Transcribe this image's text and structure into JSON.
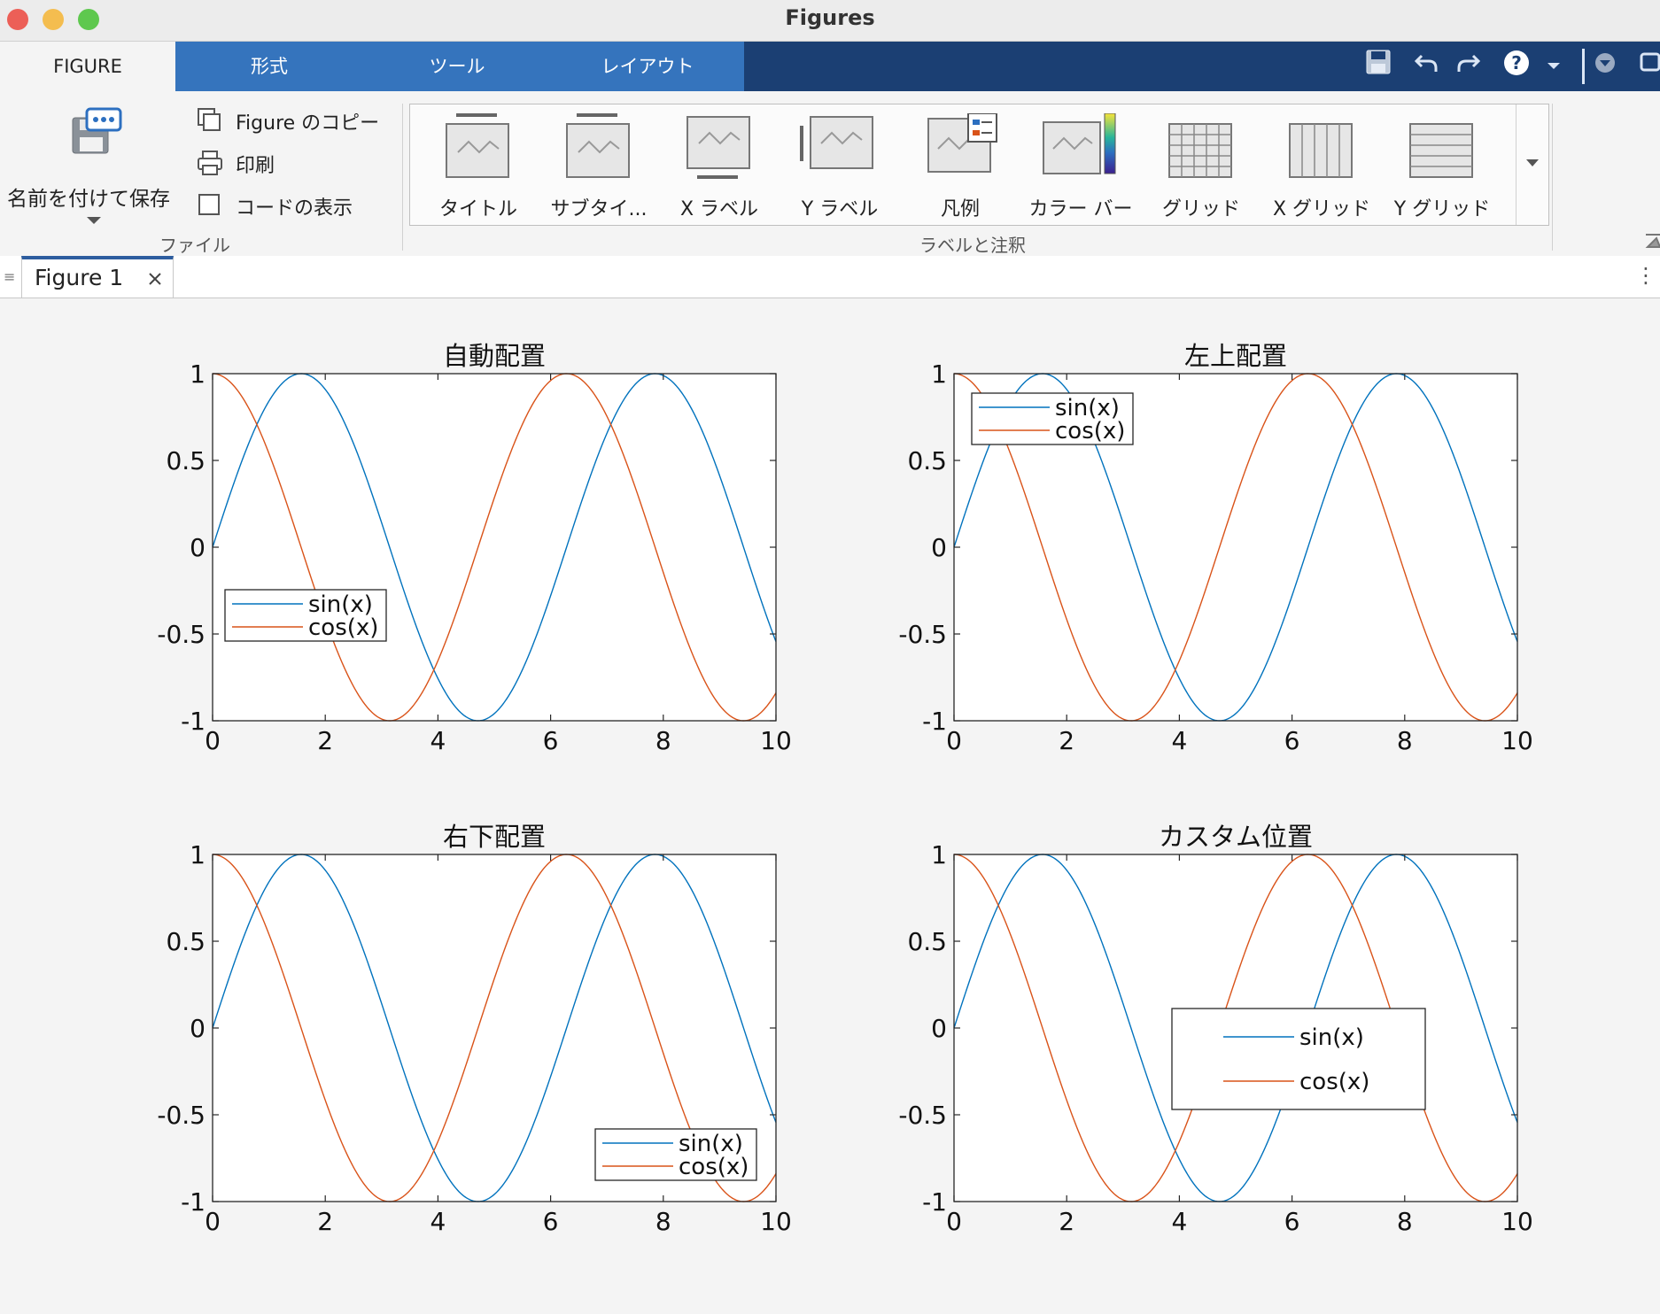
{
  "window": {
    "title": "Figures"
  },
  "ribbon_tabs": [
    "FIGURE",
    "形式",
    "ツール",
    "レイアウト"
  ],
  "file_section": {
    "save_label": "名前を付けて保存",
    "copy_label": "Figure のコピー",
    "print_label": "印刷",
    "show_code_label": "コードの表示",
    "section_label": "ファイル"
  },
  "labels_section": {
    "items": [
      "タイトル",
      "サブタイ...",
      "X ラベル",
      "Y ラベル",
      "凡例",
      "カラー バー",
      "グリッド",
      "X グリッド",
      "Y グリッド"
    ],
    "section_label": "ラベルと注釈"
  },
  "doc_tab": {
    "label": "Figure 1"
  },
  "colors": {
    "sin": "#0072BD",
    "cos": "#D95319",
    "ribbon_dark": "#1b3f73",
    "ribbon_tab": "#3574bd"
  },
  "chart_data": [
    {
      "type": "line",
      "title": "自動配置",
      "xlim": [
        0,
        10
      ],
      "ylim": [
        -1,
        1
      ],
      "xticks": [
        "0",
        "2",
        "4",
        "6",
        "8",
        "10"
      ],
      "yticks": [
        "1",
        "0.5",
        "0",
        "-0.5",
        "-1"
      ],
      "series": [
        {
          "name": "sin(x)",
          "function": "sin(x)"
        },
        {
          "name": "cos(x)",
          "function": "cos(x)"
        }
      ],
      "legend_position": "lower-left"
    },
    {
      "type": "line",
      "title": "左上配置",
      "xlim": [
        0,
        10
      ],
      "ylim": [
        -1,
        1
      ],
      "xticks": [
        "0",
        "2",
        "4",
        "6",
        "8",
        "10"
      ],
      "yticks": [
        "1",
        "0.5",
        "0",
        "-0.5",
        "-1"
      ],
      "series": [
        {
          "name": "sin(x)",
          "function": "sin(x)"
        },
        {
          "name": "cos(x)",
          "function": "cos(x)"
        }
      ],
      "legend_position": "top-left"
    },
    {
      "type": "line",
      "title": "右下配置",
      "xlim": [
        0,
        10
      ],
      "ylim": [
        -1,
        1
      ],
      "xticks": [
        "0",
        "2",
        "4",
        "6",
        "8",
        "10"
      ],
      "yticks": [
        "1",
        "0.5",
        "0",
        "-0.5",
        "-1"
      ],
      "series": [
        {
          "name": "sin(x)",
          "function": "sin(x)"
        },
        {
          "name": "cos(x)",
          "function": "cos(x)"
        }
      ],
      "legend_position": "bottom-right"
    },
    {
      "type": "line",
      "title": "カスタム位置",
      "xlim": [
        0,
        10
      ],
      "ylim": [
        -1,
        1
      ],
      "xticks": [
        "0",
        "2",
        "4",
        "6",
        "8",
        "10"
      ],
      "yticks": [
        "1",
        "0.5",
        "0",
        "-0.5",
        "-1"
      ],
      "series": [
        {
          "name": "sin(x)",
          "function": "sin(x)"
        },
        {
          "name": "cos(x)",
          "function": "cos(x)"
        }
      ],
      "legend_position": "custom"
    }
  ]
}
